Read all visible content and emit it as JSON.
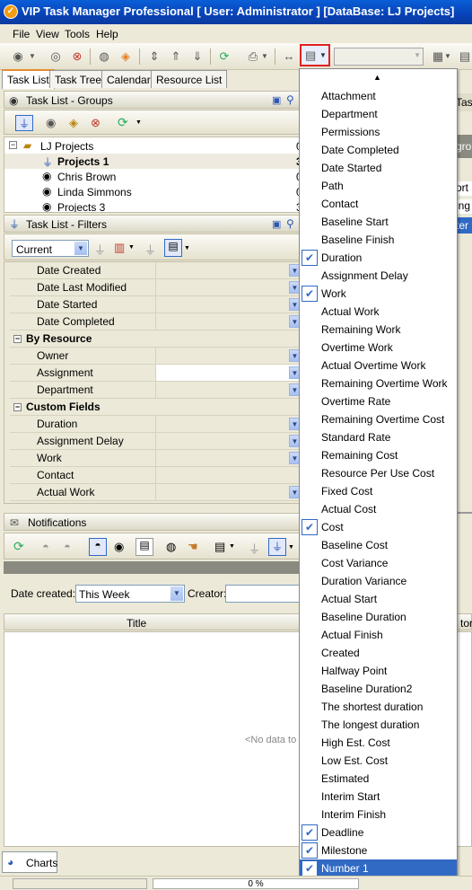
{
  "window": {
    "title": "VIP Task Manager Professional [ User: Administrator ] [DataBase: LJ Projects]"
  },
  "menubar": {
    "file": "File",
    "view": "View",
    "tools": "Tools",
    "help": "Help"
  },
  "tabs": [
    {
      "label": "Task List",
      "active": true
    },
    {
      "label": "Task Tree",
      "active": false
    },
    {
      "label": "Calendar",
      "active": false
    },
    {
      "label": "Resource List",
      "active": false
    }
  ],
  "groups_panel": {
    "title": "Task List - Groups",
    "rows": [
      {
        "label": "LJ Projects",
        "count": "0"
      },
      {
        "label": "Projects 1",
        "count": "3"
      },
      {
        "label": "Chris Brown",
        "count": "0"
      },
      {
        "label": "Linda Simmons",
        "count": "0"
      },
      {
        "label": "Projects 3",
        "count": "3"
      }
    ]
  },
  "filters_panel": {
    "title": "Task List - Filters",
    "current": "Current",
    "rows": [
      {
        "type": "field",
        "label": "Date Created",
        "dropdown": true
      },
      {
        "type": "field",
        "label": "Date Last Modified",
        "dropdown": true
      },
      {
        "type": "field",
        "label": "Date Started",
        "dropdown": true
      },
      {
        "type": "field",
        "label": "Date Completed",
        "dropdown": true
      },
      {
        "type": "group",
        "label": "By Resource"
      },
      {
        "type": "field",
        "label": "Owner",
        "dropdown": true
      },
      {
        "type": "field",
        "label": "Assignment",
        "dropdown": true,
        "white": true
      },
      {
        "type": "field",
        "label": "Department",
        "dropdown": true
      },
      {
        "type": "group",
        "label": "Custom Fields"
      },
      {
        "type": "field",
        "label": "Duration",
        "dropdown": true
      },
      {
        "type": "field",
        "label": "Assignment Delay",
        "dropdown": true
      },
      {
        "type": "field",
        "label": "Work",
        "dropdown": true
      },
      {
        "type": "field",
        "label": "Contact",
        "dropdown": false
      },
      {
        "type": "field",
        "label": "Actual Work",
        "dropdown": true
      }
    ]
  },
  "notifications": {
    "title": "Notifications",
    "date_created_label": "Date created:",
    "date_created_value": "This Week",
    "creator_label": "Creator:",
    "column_title": "Title",
    "column_partial": "tor",
    "empty_text": "<No data to d"
  },
  "charts_tab": "Charts",
  "status": {
    "progress": "0 %"
  },
  "right_fragments": {
    "task": "Task",
    "group": "grou",
    "sort": "ort",
    "ing": "ing",
    "ter": "ter"
  },
  "dropdown_menu": {
    "items": [
      {
        "label": "Attachment",
        "checked": false
      },
      {
        "label": "Department",
        "checked": false
      },
      {
        "label": "Permissions",
        "checked": false
      },
      {
        "label": "Date Completed",
        "checked": false
      },
      {
        "label": "Date Started",
        "checked": false
      },
      {
        "label": "Path",
        "checked": false
      },
      {
        "label": "Contact",
        "checked": false
      },
      {
        "label": "Baseline Start",
        "checked": false
      },
      {
        "label": "Baseline Finish",
        "checked": false
      },
      {
        "label": "Duration",
        "checked": true
      },
      {
        "label": "Assignment Delay",
        "checked": false
      },
      {
        "label": "Work",
        "checked": true
      },
      {
        "label": "Actual Work",
        "checked": false
      },
      {
        "label": "Remaining Work",
        "checked": false
      },
      {
        "label": "Overtime Work",
        "checked": false
      },
      {
        "label": "Actual Overtime Work",
        "checked": false
      },
      {
        "label": "Remaining Overtime Work",
        "checked": false
      },
      {
        "label": "Overtime Rate",
        "checked": false
      },
      {
        "label": "Remaining Overtime Cost",
        "checked": false
      },
      {
        "label": "Standard Rate",
        "checked": false
      },
      {
        "label": "Remaining Cost",
        "checked": false
      },
      {
        "label": "Resource Per Use Cost",
        "checked": false
      },
      {
        "label": "Fixed Cost",
        "checked": false
      },
      {
        "label": "Actual Cost",
        "checked": false
      },
      {
        "label": "Cost",
        "checked": true
      },
      {
        "label": "Baseline Cost",
        "checked": false
      },
      {
        "label": "Cost Variance",
        "checked": false
      },
      {
        "label": "Duration Variance",
        "checked": false
      },
      {
        "label": "Actual Start",
        "checked": false
      },
      {
        "label": "Baseline Duration",
        "checked": false
      },
      {
        "label": "Actual Finish",
        "checked": false
      },
      {
        "label": "Created",
        "checked": false
      },
      {
        "label": "Halfway Point",
        "checked": false
      },
      {
        "label": "Baseline Duration2",
        "checked": false
      },
      {
        "label": "The shortest duration",
        "checked": false
      },
      {
        "label": "The longest duration",
        "checked": false
      },
      {
        "label": "High Est. Cost",
        "checked": false
      },
      {
        "label": "Low Est. Cost",
        "checked": false
      },
      {
        "label": "Estimated",
        "checked": false
      },
      {
        "label": "Interim Start",
        "checked": false
      },
      {
        "label": "Interim Finish",
        "checked": false
      },
      {
        "label": "Deadline",
        "checked": true
      },
      {
        "label": "Milestone",
        "checked": true
      },
      {
        "label": "Number 1",
        "checked": true,
        "selected": true
      }
    ]
  }
}
